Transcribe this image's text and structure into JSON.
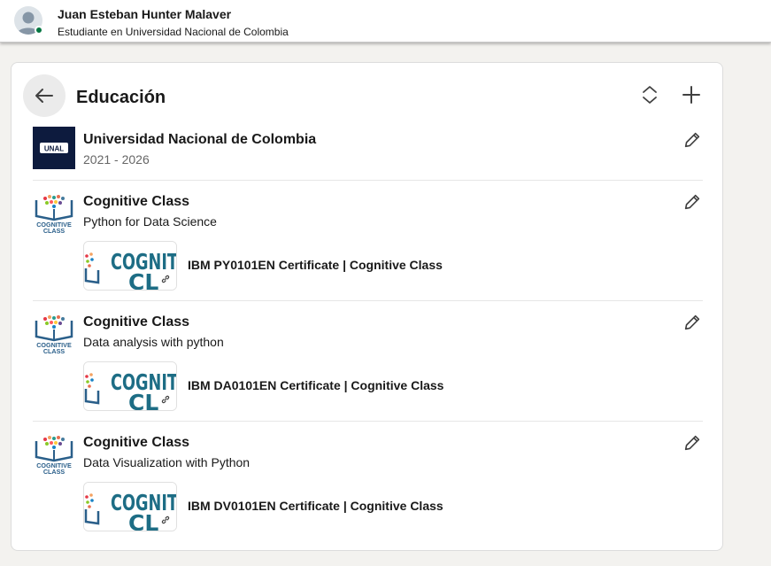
{
  "profile": {
    "name": "Juan Esteban Hunter Malaver",
    "headline": "Estudiante en Universidad Nacional de Colombia"
  },
  "section": {
    "title": "Educación",
    "icons": {
      "back": "arrow-left-icon",
      "reorder": "reorder-icon",
      "add": "plus-icon",
      "edit": "pencil-icon",
      "link": "link-icon"
    }
  },
  "unal": {
    "logo_text": "UNAL",
    "school": "Universidad Nacional de Colombia",
    "dates": "2021 - 2026"
  },
  "cognitive_logo": {
    "line1": "COGNITIVE",
    "line2": "CLASS"
  },
  "thumb_text": {
    "line1": "COGNIT",
    "line2": "CL"
  },
  "education": [
    {
      "school": "Cognitive Class",
      "degree": "Python for Data Science",
      "media_title": "IBM PY0101EN Certificate | Cognitive Class"
    },
    {
      "school": "Cognitive Class",
      "degree": "Data analysis with python",
      "media_title": "IBM DA0101EN Certificate | Cognitive Class"
    },
    {
      "school": "Cognitive Class",
      "degree": "Data Visualization with Python",
      "media_title": "IBM DV0101EN Certificate | Cognitive Class"
    }
  ],
  "colors": {
    "unal_navy": "#0d1b3e",
    "online": "#057642",
    "cognitive_blue": "#2a5f8a",
    "cognitive_teal": "#1d7a8c"
  }
}
